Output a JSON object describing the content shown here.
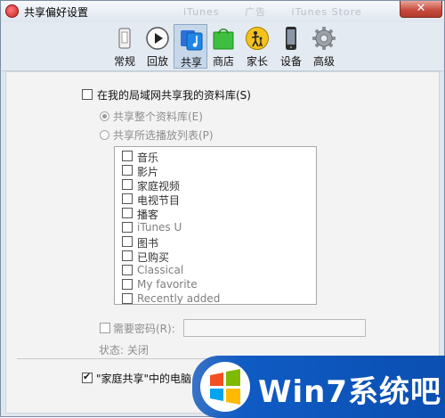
{
  "window": {
    "title": "共享偏好设置",
    "close_glyph": "✕"
  },
  "background_ghost": [
    "iTunes",
    "广告",
    "iTunes Store"
  ],
  "toolbar": {
    "active": "sharing",
    "tabs": [
      {
        "id": "general",
        "label": "常规",
        "icon": "phone-switch-icon"
      },
      {
        "id": "playback",
        "label": "回放",
        "icon": "play-icon"
      },
      {
        "id": "sharing",
        "label": "共享",
        "icon": "music-note-icon"
      },
      {
        "id": "store",
        "label": "商店",
        "icon": "shopping-bag-icon"
      },
      {
        "id": "parental",
        "label": "家长",
        "icon": "parental-figure-icon"
      },
      {
        "id": "devices",
        "label": "设备",
        "icon": "iphone-icon"
      },
      {
        "id": "advanced",
        "label": "高级",
        "icon": "gear-icon"
      }
    ]
  },
  "sharing": {
    "share_library_label": "在我的局域网共享我的资料库(S)",
    "share_library_checked": false,
    "share_entire_label": "共享整个资料库(E)",
    "share_selected_label": "共享所选播放列表(P)",
    "share_mode": "entire",
    "playlists": [
      "音乐",
      "影片",
      "家庭视频",
      "电视节目",
      "播客",
      "iTunes U",
      "图书",
      "已购买",
      "Classical",
      "My favorite",
      "Recently added"
    ],
    "require_password_label": "需要密码(R):",
    "require_password_checked": false,
    "password_value": "",
    "status_label": "状态: 关闭",
    "home_sharing_label": "\"家庭共享\"中的电脑",
    "home_sharing_checked": true
  },
  "watermark": {
    "text": "Win7系统吧"
  }
}
